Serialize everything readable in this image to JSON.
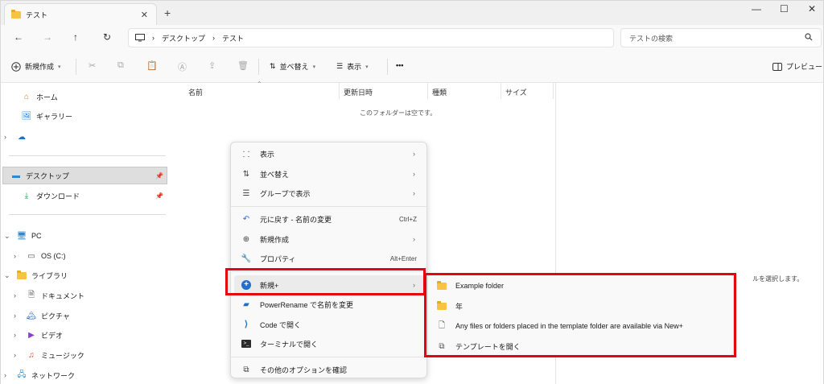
{
  "window": {
    "tab_title": "テスト",
    "tab_close": "✕",
    "new_tab": "+",
    "controls": {
      "minimize": "—",
      "maximize": "☐",
      "close": "✕"
    }
  },
  "address": {
    "back": "←",
    "forward": "→",
    "up": "↑",
    "refresh": "↻",
    "breadcrumb": [
      "デスクトップ",
      "テスト"
    ],
    "separator": "›",
    "search_placeholder": "テストの検索"
  },
  "toolbar": {
    "new_label": "新規作成",
    "sort_label": "並べ替え",
    "view_label": "表示",
    "more_label": "•••",
    "preview_label": "プレビュー"
  },
  "sidebar": {
    "items": [
      {
        "label": "ホーム"
      },
      {
        "label": "ギャラリー"
      },
      {
        "label": ""
      },
      {
        "label": "デスクトップ"
      },
      {
        "label": "ダウンロード"
      },
      {
        "label": "PC"
      },
      {
        "label": "OS (C:)"
      },
      {
        "label": "ライブラリ"
      },
      {
        "label": "ドキュメント"
      },
      {
        "label": "ピクチャ"
      },
      {
        "label": "ビデオ"
      },
      {
        "label": "ミュージック"
      },
      {
        "label": "ネットワーク"
      }
    ]
  },
  "columns": {
    "name": "名前",
    "modified": "更新日時",
    "type": "種類",
    "size": "サイズ"
  },
  "empty_message": "このフォルダーは空です。",
  "preview_message": "ルを選択します。",
  "context_menu": {
    "items": [
      {
        "label": "表示"
      },
      {
        "label": "並べ替え"
      },
      {
        "label": "グループで表示"
      },
      {
        "label": "元に戻す - 名前の変更",
        "shortcut": "Ctrl+Z"
      },
      {
        "label": "新規作成"
      },
      {
        "label": "プロパティ",
        "shortcut": "Alt+Enter"
      },
      {
        "label": "新規+"
      },
      {
        "label": "PowerRename で名前を変更"
      },
      {
        "label": "Code で開く"
      },
      {
        "label": "ターミナルで開く"
      },
      {
        "label": "その他のオプションを確認"
      }
    ]
  },
  "submenu": {
    "items": [
      {
        "label": "Example folder"
      },
      {
        "label": "年"
      },
      {
        "label": "Any files or folders placed in the template folder are available via New+"
      },
      {
        "label": "テンプレートを開く"
      }
    ]
  },
  "colors": {
    "highlight": "#e3060f",
    "accent": "#1e6fd0",
    "folder": "#f6c344"
  }
}
